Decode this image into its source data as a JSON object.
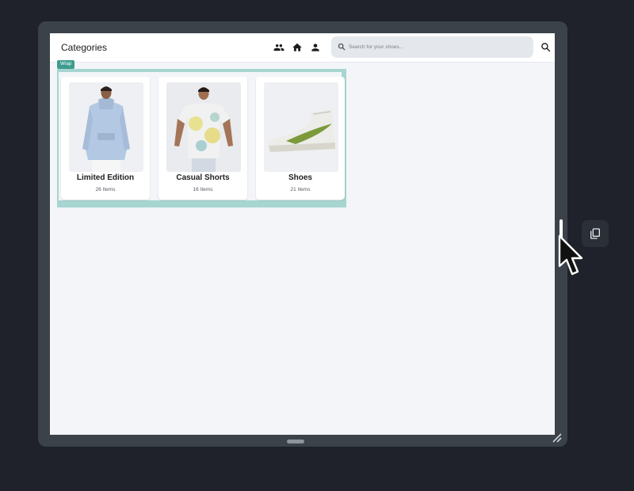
{
  "appbar": {
    "title": "Categories",
    "icons": [
      "group-icon",
      "home-icon",
      "person-icon"
    ],
    "search": {
      "placeholder": "Search for your shoes...",
      "value": ""
    },
    "search_button_icon": "search-icon"
  },
  "wrap": {
    "label": "Wrap",
    "accent_color": "#3d9c8e",
    "highlight_color": "#a6d6cf"
  },
  "categories": [
    {
      "name": "Limited Edition",
      "count": "26 Items"
    },
    {
      "name": "Casual Shorts",
      "count": "16 Items"
    },
    {
      "name": "Shoes",
      "count": "21 Items"
    }
  ],
  "tools": {
    "copy_icon": "copy-icon",
    "cursor_icon": "cursor-arrow-icon"
  }
}
